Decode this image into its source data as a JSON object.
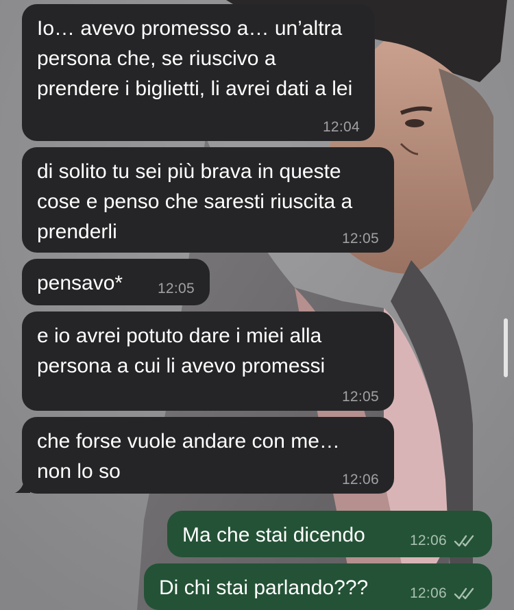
{
  "colors": {
    "wallpaper": "#8f8f91",
    "incoming_bubble": "#252527",
    "outgoing_bubble": "#245236",
    "text": "#ffffff",
    "timestamp": "#a9a9ad"
  },
  "messages": [
    {
      "direction": "incoming",
      "text": "Io… avevo promesso a… un’altra persona che, se riuscivo a prendere i biglietti, li avrei dati a lei",
      "time": "12:04"
    },
    {
      "direction": "incoming",
      "text": "di solito tu sei più brava in queste cose e penso che saresti riuscita a prenderli",
      "time": "12:05"
    },
    {
      "direction": "incoming",
      "text": "pensavo*",
      "time": "12:05"
    },
    {
      "direction": "incoming",
      "text": "e io avrei potuto dare i miei alla persona a cui li avevo promessi",
      "time": "12:05"
    },
    {
      "direction": "incoming",
      "text": "che forse vuole andare con me… non lo so",
      "time": "12:06"
    },
    {
      "direction": "outgoing",
      "text": "Ma che stai dicendo",
      "time": "12:06",
      "status_icon": "double-check-icon"
    },
    {
      "direction": "outgoing",
      "text": "Di chi stai parlando???",
      "time": "12:06",
      "status_icon": "double-check-icon"
    }
  ]
}
